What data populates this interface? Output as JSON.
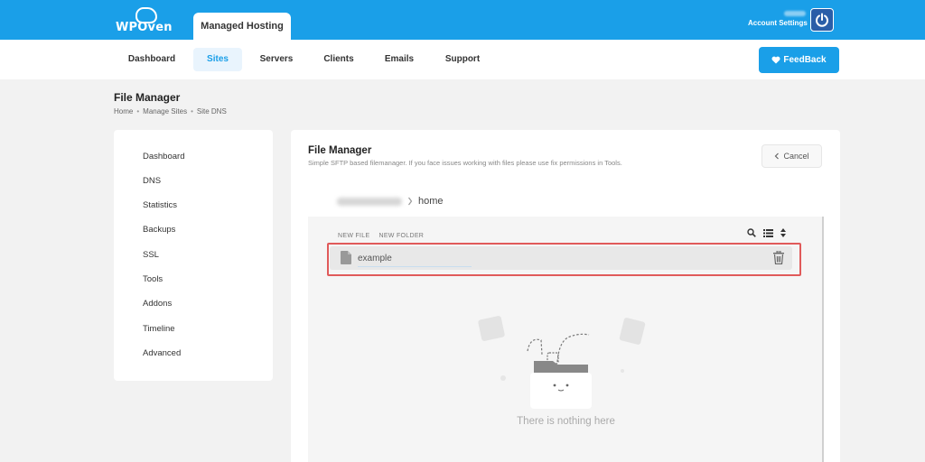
{
  "brand": {
    "logo_text": "WPOven",
    "product_tab": "Managed Hosting"
  },
  "header": {
    "account_label": "Account Settings"
  },
  "nav": {
    "items": [
      "Dashboard",
      "Sites",
      "Servers",
      "Clients",
      "Emails",
      "Support"
    ],
    "active": "Sites",
    "feedback_label": "FeedBack"
  },
  "page": {
    "title": "File Manager",
    "breadcrumb": [
      "Home",
      "Manage Sites",
      "Site DNS"
    ]
  },
  "sidebar": {
    "items": [
      "Dashboard",
      "DNS",
      "Statistics",
      "Backups",
      "SSL",
      "Tools",
      "Addons",
      "Timeline",
      "Advanced"
    ]
  },
  "panel": {
    "title": "File Manager",
    "subtitle": "Simple SFTP based filemanager. If you face issues working with files please use fix permissions in Tools.",
    "cancel_label": "Cancel"
  },
  "file_manager": {
    "path_current": "home",
    "toolbar": {
      "new_file": "NEW FILE",
      "new_folder": "NEW FOLDER"
    },
    "files": [
      {
        "name": "example",
        "type": "file"
      }
    ],
    "empty_message": "There is nothing here"
  },
  "colors": {
    "brand_blue": "#1a9fe8",
    "highlight_red": "#e05a5a"
  },
  "icons": [
    "power-icon",
    "heart-icon",
    "chevron-left-icon",
    "chevron-right-icon",
    "search-icon",
    "list-icon",
    "sort-icon",
    "file-icon",
    "trash-icon"
  ]
}
